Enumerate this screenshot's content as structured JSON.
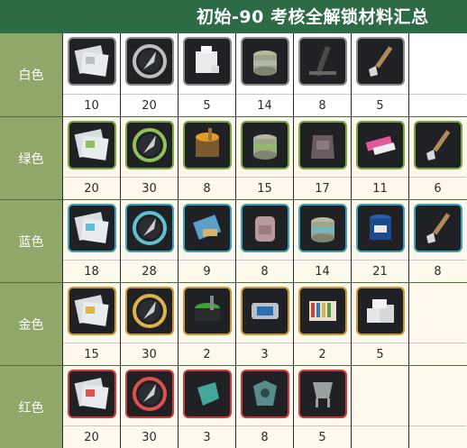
{
  "title": "初始-90 考核全解锁材料汇总",
  "tiers": [
    {
      "label": "白色",
      "tier": "white",
      "items": [
        {
          "icon": "stamp-paper-icon",
          "count": "10"
        },
        {
          "icon": "feather-emblem-icon",
          "count": "20"
        },
        {
          "icon": "glue-box-icon",
          "count": "5"
        },
        {
          "icon": "paint-tin-icon",
          "count": "14"
        },
        {
          "icon": "ink-stick-icon",
          "count": "8"
        },
        {
          "icon": "paintbrush-icon",
          "count": "5"
        },
        {
          "icon": "",
          "count": ""
        }
      ]
    },
    {
      "label": "绿色",
      "tier": "green",
      "items": [
        {
          "icon": "stamp-paper-icon",
          "count": "20"
        },
        {
          "icon": "feather-emblem-icon",
          "count": "30"
        },
        {
          "icon": "paint-bucket-icon",
          "count": "8"
        },
        {
          "icon": "paint-tin-icon",
          "count": "15"
        },
        {
          "icon": "pouch-icon",
          "count": "17"
        },
        {
          "icon": "paint-tube-icon",
          "count": "11"
        },
        {
          "icon": "paintbrush-icon",
          "count": "6"
        }
      ]
    },
    {
      "label": "蓝色",
      "tier": "blue",
      "items": [
        {
          "icon": "stamp-paper-icon",
          "count": "18"
        },
        {
          "icon": "feather-emblem-icon",
          "count": "28"
        },
        {
          "icon": "scroll-icon",
          "count": "9"
        },
        {
          "icon": "backpack-icon",
          "count": "8"
        },
        {
          "icon": "paint-tin-icon",
          "count": "14"
        },
        {
          "icon": "paint-barrel-icon",
          "count": "21"
        },
        {
          "icon": "paintbrush-icon",
          "count": "8"
        }
      ]
    },
    {
      "label": "金色",
      "tier": "gold",
      "items": [
        {
          "icon": "stamp-paper-icon",
          "count": "15"
        },
        {
          "icon": "feather-emblem-icon",
          "count": "30"
        },
        {
          "icon": "green-paint-tin-icon",
          "count": "2"
        },
        {
          "icon": "device-icon",
          "count": "3"
        },
        {
          "icon": "color-palette-icon",
          "count": "2"
        },
        {
          "icon": "paper-stack-icon",
          "count": "5"
        },
        {
          "icon": "",
          "count": ""
        }
      ]
    },
    {
      "label": "红色",
      "tier": "red",
      "items": [
        {
          "icon": "stamp-paper-icon",
          "count": "20"
        },
        {
          "icon": "feather-emblem-icon",
          "count": "30"
        },
        {
          "icon": "jade-fragment-icon",
          "count": "3"
        },
        {
          "icon": "jade-ornament-icon",
          "count": "8"
        },
        {
          "icon": "bronze-vessel-icon",
          "count": "5"
        },
        {
          "icon": "",
          "count": ""
        },
        {
          "icon": "",
          "count": ""
        }
      ]
    }
  ],
  "colors": {
    "header": "#2d6b46",
    "label_bg": "#8fa86a",
    "white_tier": "#8b8b8b",
    "green_tier": "#79a83d",
    "blue_tier": "#3aa4b8",
    "gold_tier": "#c99a33",
    "red_tier": "#d03a3a"
  }
}
